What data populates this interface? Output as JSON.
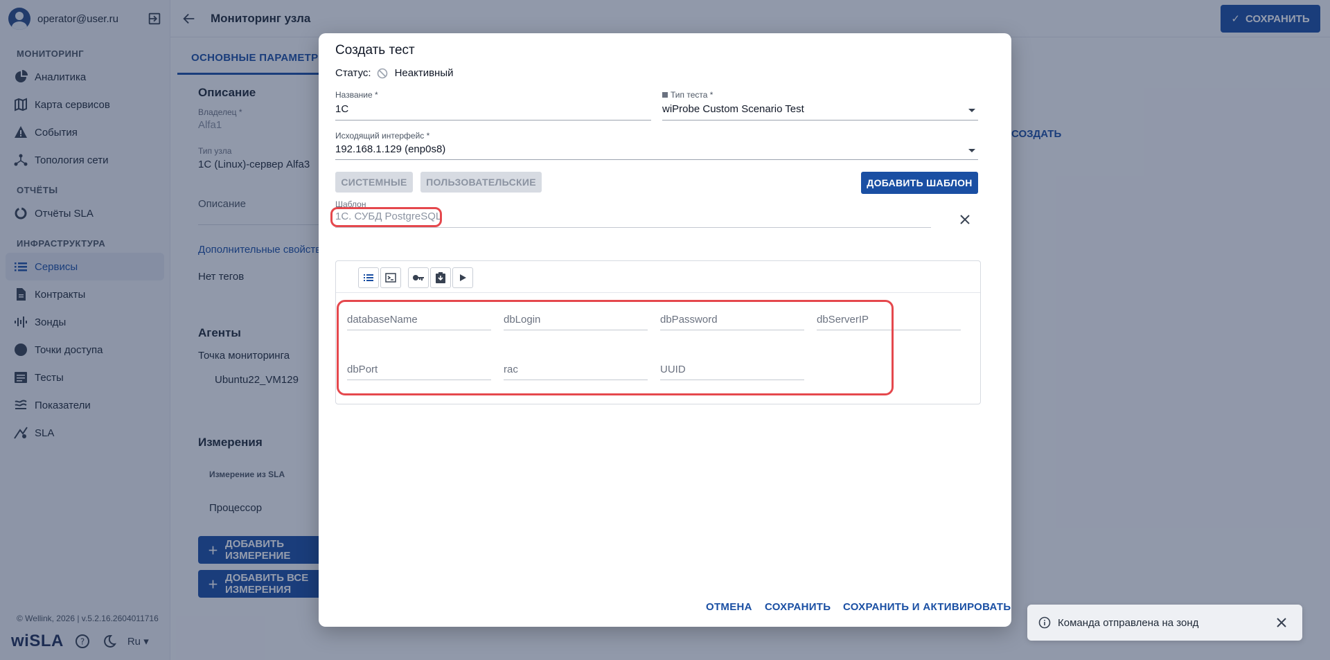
{
  "sidebar": {
    "user_email": "operator@user.ru",
    "sections": {
      "monitoring": "МОНИТОРИНГ",
      "reports": "ОТЧЁТЫ",
      "infra": "ИНФРАСТРУКТУРА"
    },
    "items": {
      "analytics": "Аналитика",
      "service_map": "Карта сервисов",
      "events": "События",
      "topology": "Топология сети",
      "sla_reports": "Отчёты SLA",
      "services": "Сервисы",
      "contracts": "Контракты",
      "probes": "Зонды",
      "access_points": "Точки доступа",
      "tests": "Тесты",
      "metrics": "Показатели",
      "sla": "SLA"
    },
    "copyright": "© Wellink, 2026 | v.5.2.16.2604011716",
    "logo": "wiSLA",
    "lang": "Ru"
  },
  "page": {
    "title": "Мониторинг узла",
    "save_label": "СОХРАНИТЬ",
    "tab_main": "ОСНОВНЫЕ ПАРАМЕТРЫ",
    "description_heading": "Описание",
    "owner_label": "Владелец *",
    "owner_value": "Alfa1",
    "node_type_label": "Тип узла",
    "node_type_value": "1С (Linux)-сервер Alfa3",
    "description_label": "Описание",
    "extra_props_link": "Дополнительные свойства",
    "no_tags": "Нет тегов",
    "agents_heading": "Агенты",
    "monitoring_point_label": "Точка мониторинга",
    "monitoring_point_value": "Ubuntu22_VM129",
    "measurements_heading": "Измерения",
    "measurement_col": "Измерение из SLA",
    "measurement_row": "Процессор",
    "add_measurement_btn": "ДОБАВИТЬ ИЗМЕРЕНИЕ",
    "add_all_btn": "ДОБАВИТЬ ВСЕ ИЗМЕРЕНИЯ",
    "create_link": "СОЗДАТЬ"
  },
  "modal": {
    "title": "Создать тест",
    "status_label": "Статус:",
    "status_value": "Неактивный",
    "name_label": "Название *",
    "name_value": "1C",
    "test_type_label": "Тип теста *",
    "test_type_value": "wiProbe Custom Scenario Test",
    "interface_label": "Исходящий интерфейс *",
    "interface_value": "192.168.1.129 (enp0s8)",
    "system_btn": "СИСТЕМНЫЕ",
    "user_btn": "ПОЛЬЗОВАТЕЛЬСКИЕ",
    "add_template_btn": "ДОБАВИТЬ ШАБЛОН",
    "template_label": "Шаблон",
    "template_value": "1С. СУБД PostgreSQL",
    "params": {
      "database_name": "databaseName",
      "db_login": "dbLogin",
      "db_password": "dbPassword",
      "db_server_ip": "dbServerIP",
      "db_port": "dbPort",
      "rac": "rac",
      "uuid": "UUID"
    },
    "cancel_btn": "ОТМЕНА",
    "save_btn": "СОХРАНИТЬ",
    "save_activate_btn": "СОХРАНИТЬ И АКТИВИРОВАТЬ"
  },
  "toast": {
    "message": "Команда отправлена на зонд"
  },
  "colors": {
    "accent": "#1a4fa3",
    "highlight": "#e5484d"
  }
}
